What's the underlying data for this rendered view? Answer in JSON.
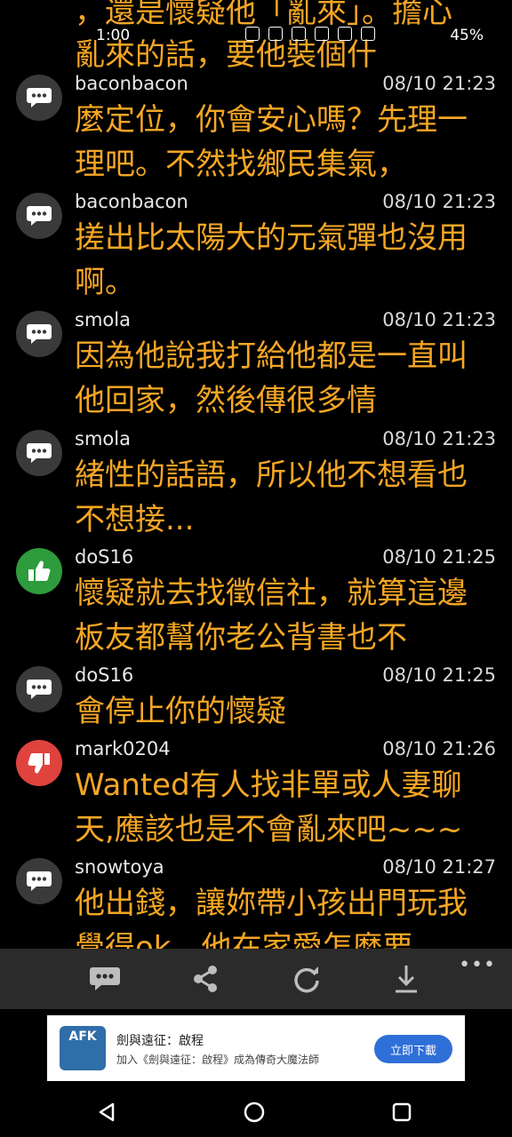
{
  "status_bar": {
    "time": "1:00",
    "battery": "45%"
  },
  "partial_top": [
    "，還是懷疑他「亂來」。擔心",
    "亂來的話，要他裝個什"
  ],
  "comments": [
    {
      "author": "baconbacon",
      "time": "08/10 21:23",
      "type": "comment",
      "lines": [
        "麼定位，你會安心嗎？先理一",
        "理吧。不然找鄉民集氣，"
      ]
    },
    {
      "author": "baconbacon",
      "time": "08/10 21:23",
      "type": "comment",
      "lines": [
        "搓出比太陽大的元氣彈也沒用",
        "啊。"
      ]
    },
    {
      "author": "smola",
      "time": "08/10 21:23",
      "type": "comment",
      "lines": [
        "因為他說我打給他都是一直叫",
        "他回家，然後傳很多情"
      ]
    },
    {
      "author": "smola",
      "time": "08/10 21:23",
      "type": "comment",
      "lines": [
        "緒性的話語，所以他不想看也",
        "不想接..."
      ]
    },
    {
      "author": "doS16",
      "time": "08/10 21:25",
      "type": "like",
      "lines": [
        "懷疑就去找徵信社，就算這邊",
        "板友都幫你老公背書也不"
      ]
    },
    {
      "author": "doS16",
      "time": "08/10 21:25",
      "type": "comment",
      "lines": [
        "會停止你的懷疑"
      ]
    },
    {
      "author": "mark0204",
      "time": "08/10 21:26",
      "type": "dislike",
      "lines": [
        "Wanted有人找非單或人妻聊",
        "天,應該也是不會亂來吧~~~"
      ]
    },
    {
      "author": "snowtoya",
      "time": "08/10 21:27",
      "type": "comment",
      "lines": [
        "他出錢，讓妳帶小孩出門玩我",
        "覺得ok，他在家愛怎麼要"
      ]
    }
  ],
  "toolbar": {
    "icons": [
      "comment-icon",
      "share-icon",
      "refresh-icon",
      "download-icon"
    ],
    "more": "•••"
  },
  "ad": {
    "logo": "AFK",
    "title": "劍與遠征：啟程",
    "subtitle": "加入《劍與遠征：啟程》成為傳奇大魔法師",
    "button": "立即下載",
    "accent": "#2f6fd8"
  },
  "colors": {
    "comment_text": "#f5a623",
    "like": "#2e9b3c",
    "dislike": "#e0423e",
    "toolbar_bg": "#2b2b2b"
  }
}
